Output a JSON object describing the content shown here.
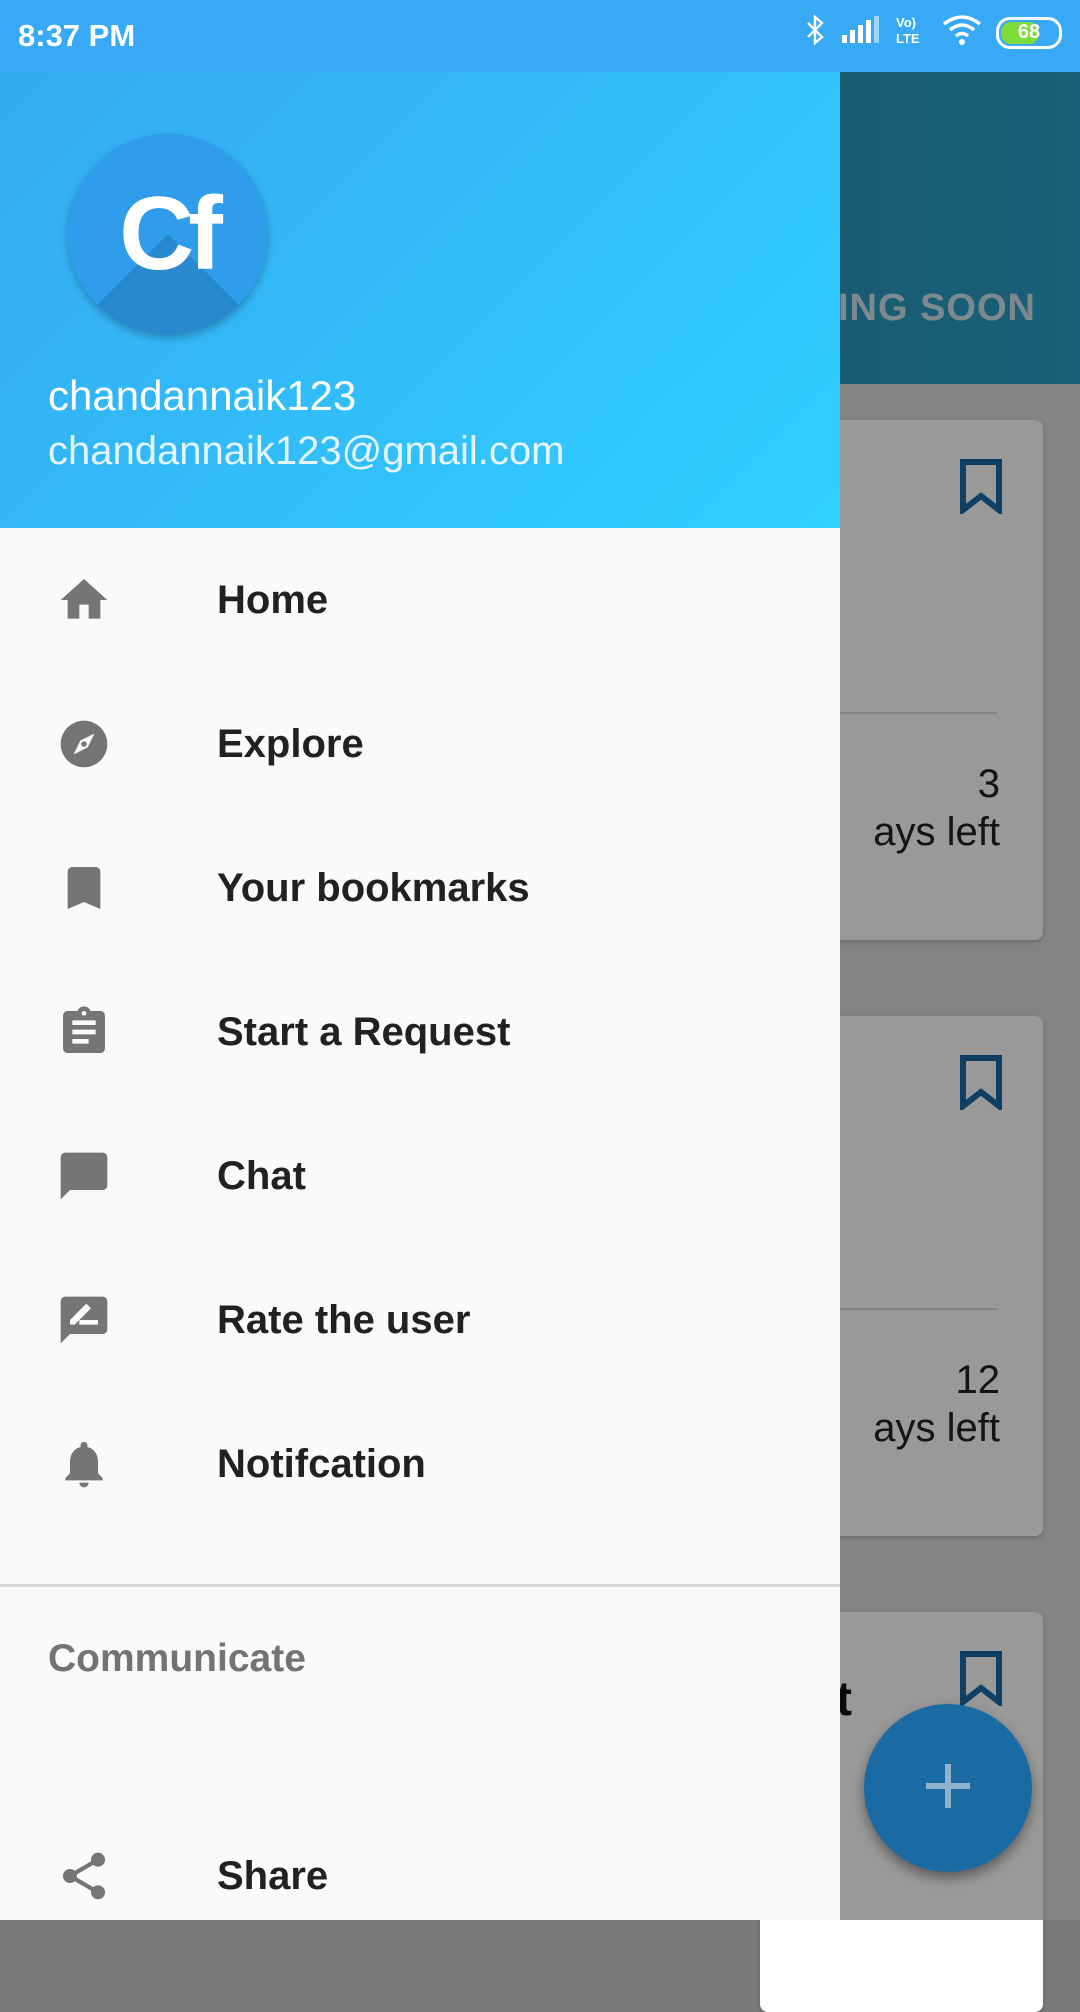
{
  "status_bar": {
    "time": "8:37 PM",
    "battery": "68",
    "icons": [
      "bluetooth-icon",
      "signal-icon",
      "volte-icon",
      "wifi-icon",
      "battery-icon"
    ]
  },
  "background_app": {
    "tab_label": "ING SOON",
    "cards": [
      {
        "days_number": "3",
        "days_label": "ays left"
      },
      {
        "days_number": "12",
        "days_label": "ays left"
      },
      {
        "partial_text": "t"
      }
    ],
    "fab_icon": "plus-icon"
  },
  "drawer": {
    "header": {
      "avatar_initials": "Cf",
      "username": "chandannaik123",
      "email": "chandannaik123@gmail.com"
    },
    "items": [
      {
        "label": "Home",
        "icon": "home-icon"
      },
      {
        "label": "Explore",
        "icon": "compass-icon"
      },
      {
        "label": "Your bookmarks",
        "icon": "bookmark-icon"
      },
      {
        "label": "Start a Request",
        "icon": "clipboard-icon"
      },
      {
        "label": "Chat",
        "icon": "chat-icon"
      },
      {
        "label": "Rate the user",
        "icon": "rate-review-icon"
      },
      {
        "label": "Notifcation",
        "icon": "bell-icon"
      }
    ],
    "section_title": "Communicate",
    "communicate_items": [
      {
        "label": "Share",
        "icon": "share-icon"
      }
    ]
  },
  "colors": {
    "status_bar": "#38a9f5",
    "header_start": "#35a9f2",
    "header_end": "#2fd0ff",
    "icon_gray": "#757575",
    "fab": "#1a6aa3"
  }
}
